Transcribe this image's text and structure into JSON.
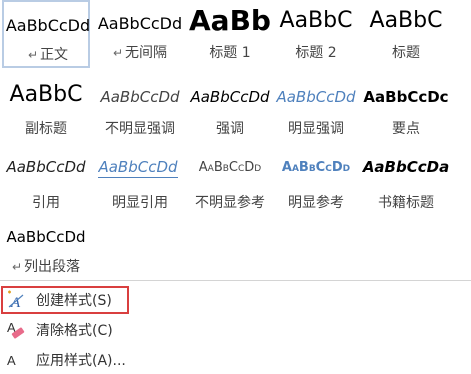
{
  "gallery": {
    "row1": [
      {
        "preview": "AaBbCcDd",
        "name": "正文",
        "para_mark": "↵"
      },
      {
        "preview": "AaBbCcDd",
        "name": "无间隔",
        "para_mark": "↵"
      },
      {
        "preview": "AaBb",
        "name": "标题 1"
      },
      {
        "preview": "AaBbC",
        "name": "标题 2"
      },
      {
        "preview": "AaBbC",
        "name": "标题"
      }
    ],
    "row2": [
      {
        "preview": "AaBbC",
        "name": "副标题"
      },
      {
        "preview": "AaBbCcDd",
        "name": "不明显强调"
      },
      {
        "preview": "AaBbCcDd",
        "name": "强调"
      },
      {
        "preview": "AaBbCcDd",
        "name": "明显强调"
      },
      {
        "preview": "AaBbCcDc",
        "name": "要点"
      }
    ],
    "row3": [
      {
        "preview": "AaBbCcDd",
        "name": "引用"
      },
      {
        "preview": "AaBbCcDd",
        "name": "明显引用"
      },
      {
        "preview": "AaBbCcDd",
        "name": "不明显参考"
      },
      {
        "preview": "AaBbCcDd",
        "name": "明显参考"
      },
      {
        "preview": "AaBbCcDa",
        "name": "书籍标题"
      }
    ],
    "row4": [
      {
        "preview": "AaBbCcDd",
        "name": "列出段落",
        "para_mark": "↵"
      }
    ]
  },
  "menu": {
    "create_style": "创建样式(S)",
    "clear_format": "清除格式(C)",
    "apply_styles": "应用样式(A)..."
  },
  "colors": {
    "selected_border": "#b9cce4",
    "highlight_border": "#d93f3f",
    "accent_blue": "#4f81bd"
  }
}
